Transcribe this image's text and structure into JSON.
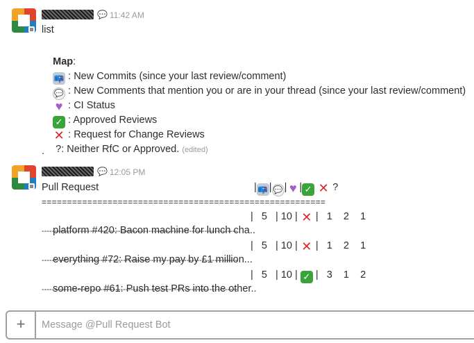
{
  "messages": [
    {
      "time": "11:42 AM",
      "text": "list",
      "map_title": "Map",
      "map_colon": ":",
      "legend": [
        {
          "icon": "mailbox",
          "text": " : New Commits (since your last review/comment)"
        },
        {
          "icon": "speech",
          "text": " : New Comments that mention you or are in your thread (since your last review/comment)"
        },
        {
          "icon": "heart",
          "text": " : CI Status"
        },
        {
          "icon": "check",
          "text": " : Approved Reviews"
        },
        {
          "icon": "cross",
          "text": " : Request for Change Reviews"
        }
      ],
      "neither": " ?: Neither RfC or Approved.",
      "edited": "(edited)",
      "dot": "."
    },
    {
      "time": "12:05 PM",
      "header_label": "Pull Request",
      "header_tail": "?",
      "separator_double": "========================================================",
      "separator_single": "-----------------------------------------------------------------------------",
      "rows": [
        {
          "title": "platform #420: Bacon machine for lunch cha..",
          "commits": "5",
          "comments": "10",
          "review": "cross",
          "a": "1",
          "b": "2",
          "c": "1"
        },
        {
          "title": "everything #72: Raise my pay by £1 million...",
          "commits": "5",
          "comments": "10",
          "review": "cross",
          "a": "1",
          "b": "2",
          "c": "1"
        },
        {
          "title": "some-repo #61: Push test PRs into the other..",
          "commits": "5",
          "comments": "10",
          "review": "check",
          "a": "3",
          "b": "1",
          "c": "2"
        }
      ]
    }
  ],
  "composer": {
    "plus": "+",
    "placeholder": "Message @Pull Request Bot"
  },
  "icons": {
    "mailbox": "📪",
    "speech": "💬",
    "heart": "♥",
    "check": "✓",
    "cross": "✕"
  }
}
